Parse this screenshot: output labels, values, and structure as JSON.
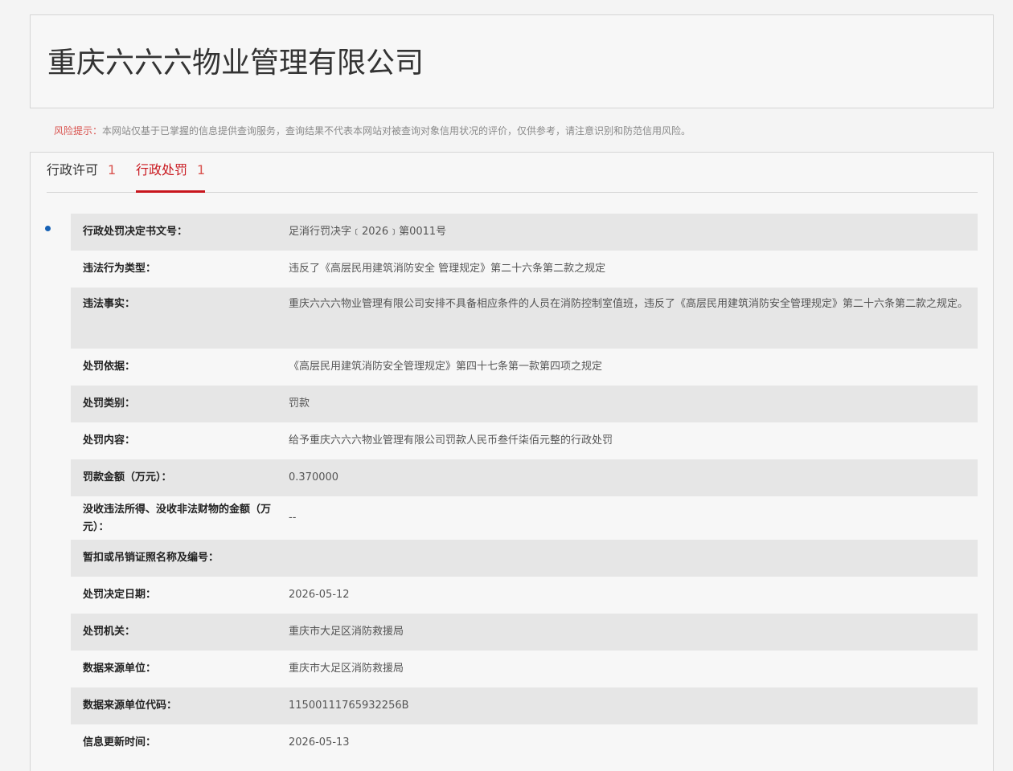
{
  "company": {
    "name": "重庆六六六物业管理有限公司"
  },
  "risk": {
    "label": "风险提示：",
    "text": "本网站仅基于已掌握的信息提供查询服务，查询结果不代表本网站对被查询对象信用状况的评价，仅供参考，请注意识别和防范信用风险。"
  },
  "tabs": [
    {
      "label": "行政许可",
      "count": "1"
    },
    {
      "label": "行政处罚",
      "count": "1"
    }
  ],
  "colors": {
    "accent": "#c8161d",
    "bullet": "#1661b5"
  },
  "record": {
    "rows": [
      {
        "label": "行政处罚决定书文号：",
        "value": "足消行罚决字﹝2026﹞第0011号"
      },
      {
        "label": "违法行为类型：",
        "value": "违反了《高层民用建筑消防安全 管理规定》第二十六条第二款之规定"
      },
      {
        "label": "违法事实：",
        "value": "重庆六六六物业管理有限公司安排不具备相应条件的人员在消防控制室值班，违反了《高层民用建筑消防安全管理规定》第二十六条第二款之规定。"
      },
      {
        "label": "处罚依据：",
        "value": "《高层民用建筑消防安全管理规定》第四十七条第一款第四项之规定"
      },
      {
        "label": "处罚类别：",
        "value": "罚款"
      },
      {
        "label": "处罚内容：",
        "value": "给予重庆六六六物业管理有限公司罚款人民币叁仟柒佰元整的行政处罚"
      },
      {
        "label": "罚款金额（万元）：",
        "value": "0.370000"
      },
      {
        "label": "没收违法所得、没收非法财物的金额（万元）：",
        "value": "--"
      },
      {
        "label": "暂扣或吊销证照名称及编号：",
        "value": ""
      },
      {
        "label": "处罚决定日期：",
        "value": "2026-05-12"
      },
      {
        "label": "处罚机关：",
        "value": "重庆市大足区消防救援局"
      },
      {
        "label": "数据来源单位：",
        "value": "重庆市大足区消防救援局"
      },
      {
        "label": "数据来源单位代码：",
        "value": "11500111765932256B"
      },
      {
        "label": "信息更新时间：",
        "value": "2026-05-13"
      }
    ]
  }
}
